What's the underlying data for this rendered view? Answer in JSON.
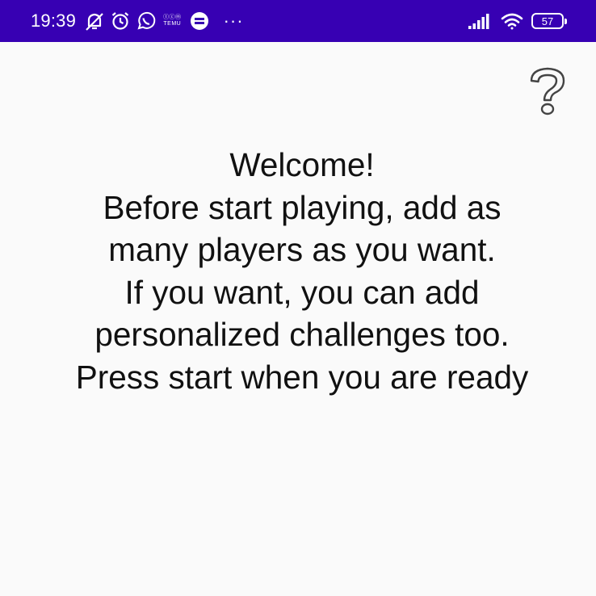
{
  "status_bar": {
    "time": "19:39",
    "icons_left": [
      "notifications-off-icon",
      "alarm-icon",
      "whatsapp-icon",
      "temu-icon",
      "app-icon",
      "more-icon"
    ],
    "temu_label_top": "ⓣⓒⓜ",
    "temu_label": "TEMU",
    "more": "···",
    "icons_right": [
      "signal-icon",
      "wifi-icon",
      "battery-icon"
    ],
    "battery_level": "57",
    "background_color": "#3700b3"
  },
  "help": {
    "icon": "question-mark-icon"
  },
  "welcome": {
    "lines": [
      "Welcome!",
      "Before start playing, add as",
      "many players as you want.",
      "If you want, you can add",
      "personalized challenges too.",
      "Press start when you are ready"
    ]
  }
}
